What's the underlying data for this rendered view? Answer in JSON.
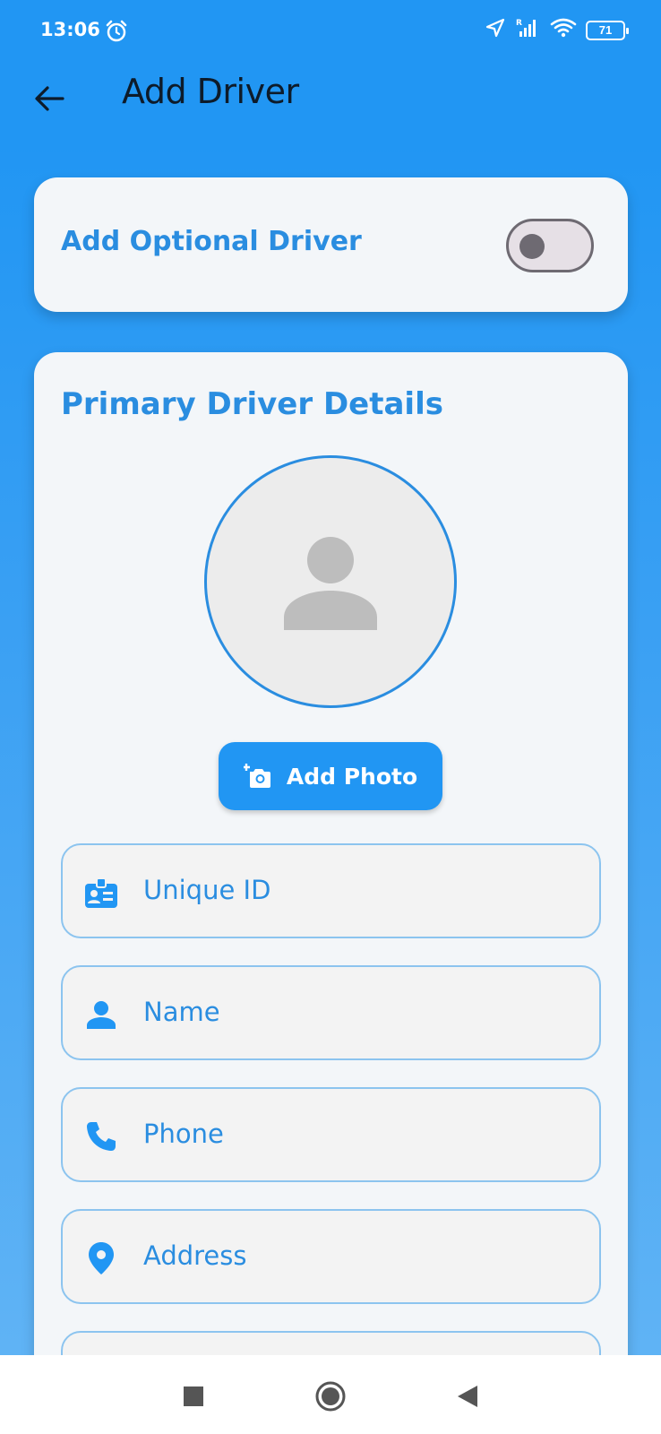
{
  "status_bar": {
    "time": "13:06",
    "battery": "71",
    "icons": [
      "alarm-icon",
      "location-arrow-icon",
      "signal-icon",
      "wifi-icon",
      "battery-icon"
    ]
  },
  "app_bar": {
    "title": "Add Driver",
    "back_icon": "arrow-back-icon"
  },
  "optional_driver": {
    "label": "Add Optional Driver",
    "toggle_on": false
  },
  "primary": {
    "section_title": "Primary Driver Details",
    "avatar_icon": "person-placeholder-icon",
    "add_photo_label": "Add Photo",
    "fields": [
      {
        "label": "Unique ID",
        "icon": "id-badge-icon"
      },
      {
        "label": "Name",
        "icon": "person-icon"
      },
      {
        "label": "Phone",
        "icon": "phone-icon"
      },
      {
        "label": "Address",
        "icon": "location-pin-icon"
      }
    ]
  },
  "nav_bar": {
    "icons": [
      "recents-square-icon",
      "home-circle-icon",
      "back-triangle-icon"
    ]
  },
  "colors": {
    "primary": "#2196f3",
    "accent_text": "#2a8de0",
    "card_bg": "#f3f6f9",
    "field_border": "#8cc4ef"
  }
}
